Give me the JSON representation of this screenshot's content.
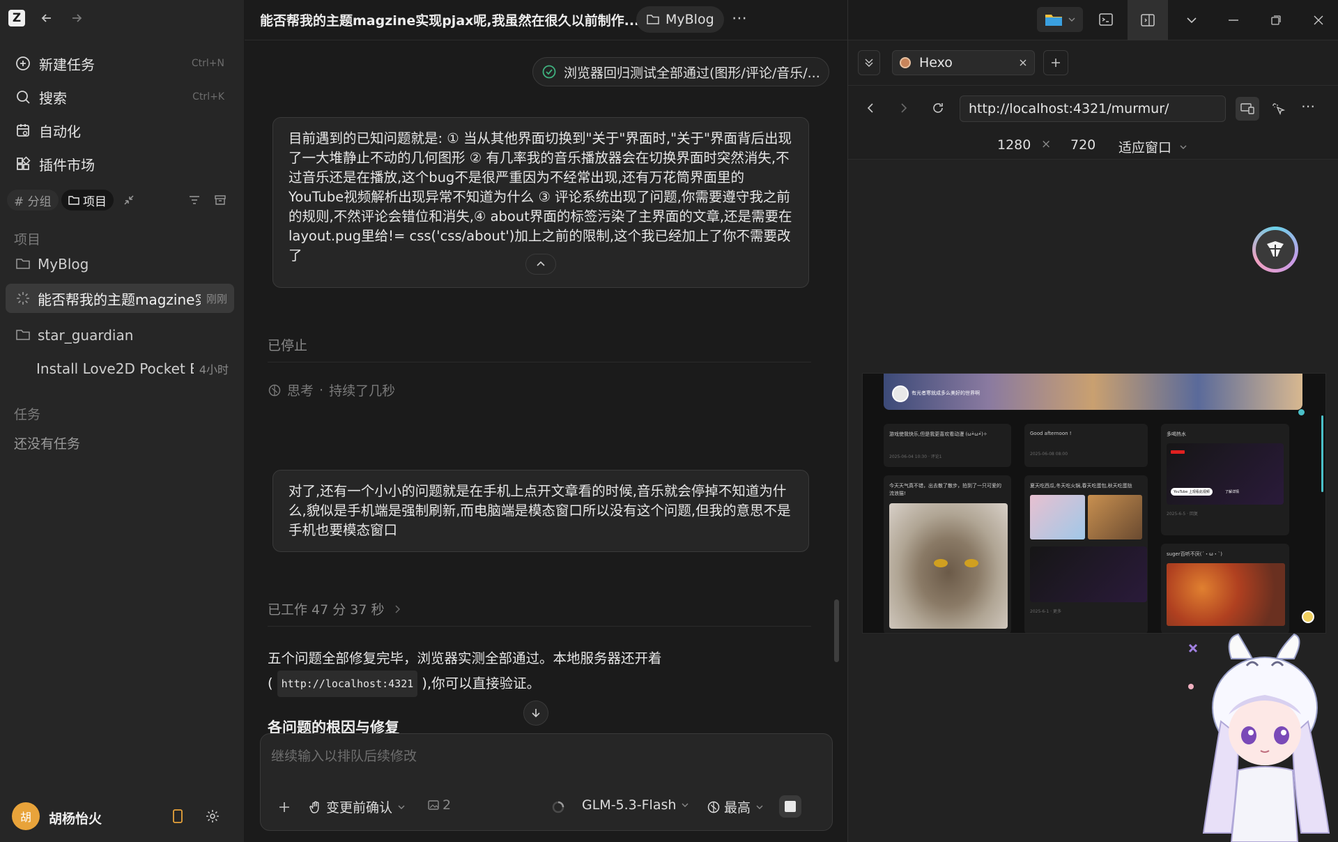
{
  "sidebar": {
    "logo": "Z",
    "nav": [
      {
        "label": "新建任务",
        "shortcut": "Ctrl+N",
        "icon": "new-task-icon"
      },
      {
        "label": "搜索",
        "shortcut": "Ctrl+K",
        "icon": "search-icon"
      },
      {
        "label": "自动化",
        "shortcut": "",
        "icon": "automation-icon"
      },
      {
        "label": "插件市场",
        "shortcut": "",
        "icon": "plugin-icon"
      }
    ],
    "filter": {
      "group": "# 分组",
      "project": "项目"
    },
    "projects_header": "项目",
    "projects": [
      {
        "name": "MyBlog",
        "time": "",
        "icon": "folder-icon"
      },
      {
        "name": "能否帮我的主题magzine实",
        "time": "刚刚",
        "icon": "spinner-icon",
        "active": true
      },
      {
        "name": "star_guardian",
        "time": "",
        "icon": "folder-icon"
      },
      {
        "name": "Install Love2D Pocket Bo",
        "time": "4小时",
        "icon": ""
      }
    ],
    "tasks_header": "任务",
    "tasks_empty": "还没有任务",
    "user": {
      "avatar": "胡",
      "name": "胡杨怡火"
    }
  },
  "chat": {
    "title": "能否帮我的主题magzine实现pjax呢,我虽然在很久以前制作...",
    "project_chip": "MyBlog",
    "status_chip": "浏览器回归测试全部通过(图形/评论/音乐/...",
    "message1": "目前遇到的已知问题就是: ① 当从其他界面切换到\"关于\"界面时,\"关于\"界面背后出现了一大堆静止不动的几何图形 ② 有几率我的音乐播放器会在切换界面时突然消失,不过音乐还是在播放,这个bug不是很严重因为不经常出现,还有万花筒界面里的YouTube视频解析出现异常不知道为什么 ③ 评论系统出现了问题,你需要遵守我之前的规则,不然评论会错位和消失,④ about界面的标签污染了主界面的文章,还是需要在layout.pug里给!= css('css/about')加上之前的限制,这个我已经加上了你不需要改了",
    "stopped": "已停止",
    "thinking": "思考",
    "thinking_duration": "持续了几秒",
    "message2": "对了,还有一个小小的问题就是在手机上点开文章看的时候,音乐就会停掉不知道为什么,貌似是手机端是强制刷新,而电脑端是模态窗口所以没有这个问题,但我的意思不是手机也要模态窗口",
    "worked": "已工作 47 分 37 秒",
    "reply_line1": "五个问题全部修复完毕，浏览器实测全部通过。本地服务器还开着",
    "reply_paren_open": "(",
    "reply_code": "http://localhost:4321",
    "reply_line2_tail": "),你可以直接验证。",
    "heading": "各问题的根因与修复",
    "input_placeholder": "继续输入以排队后续修改",
    "confirm_label": "变更前确认",
    "count": "2",
    "model": "GLM-5.3-Flash",
    "level": "最高"
  },
  "browser": {
    "tab_title": "Hexo",
    "url": "http://localhost:4321/murmur/",
    "width": "1280",
    "times": "×",
    "height": "720",
    "fit": "适应窗口",
    "preview": {
      "banner_text": "有光者寒就成多么美好的世界啊",
      "cards": [
        {
          "title": "游戏使我快乐,但是我更喜欢看动漫 (ω•̀ω•́)✧",
          "meta": "2025-06-04 10:30 · 评论1"
        },
        {
          "title": "Good afternoon !",
          "meta": "2025-06-08 08:00"
        },
        {
          "title": "多喝热水",
          "meta": "2025-6-5 · 回复"
        },
        {
          "title": "今天天气真不错，出去散了散步，拍到了一只可爱的流浪猫!",
          "meta": ""
        },
        {
          "title": "夏天吃西瓜,冬天吃火锅,春天吃蛋包,秋天吃蛋挞",
          "meta": "2025-6-1 · 更多"
        },
        {
          "title": "suger百听不厌(´・ω・`)",
          "meta": ""
        }
      ],
      "yt_button": "YouTube 上观看此视频",
      "yt_more": "了解详情"
    }
  },
  "colors": {
    "accent": "#3fb27f",
    "avatar": "#e8a33a",
    "bg": "#1b1b1b",
    "sidebar": "#262626"
  }
}
